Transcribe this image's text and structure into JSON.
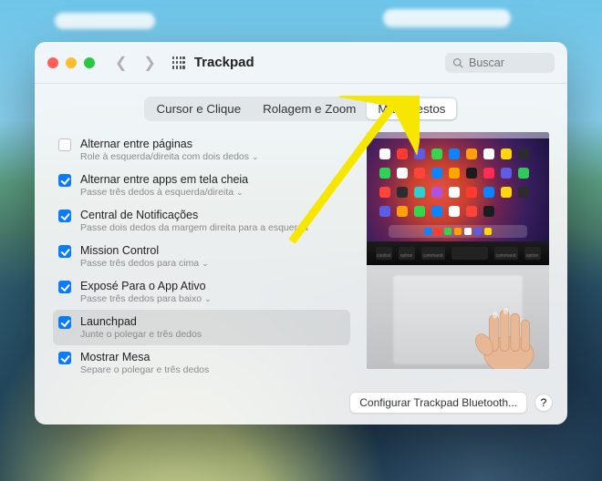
{
  "window": {
    "title": "Trackpad"
  },
  "search": {
    "placeholder": "Buscar"
  },
  "tabs": [
    {
      "label": "Cursor e Clique",
      "active": false
    },
    {
      "label": "Rolagem e Zoom",
      "active": false
    },
    {
      "label": "Mais Gestos",
      "active": true
    }
  ],
  "options": [
    {
      "checked": false,
      "title": "Alternar entre páginas",
      "sub": "Role à esquerda/direita com dois dedos",
      "dropdown": true,
      "selected": false
    },
    {
      "checked": true,
      "title": "Alternar entre apps em tela cheia",
      "sub": "Passe três dedos à esquerda/direita",
      "dropdown": true,
      "selected": false
    },
    {
      "checked": true,
      "title": "Central de Notificações",
      "sub": "Passe dois dedos da margem direita para a esquerda",
      "dropdown": false,
      "selected": false
    },
    {
      "checked": true,
      "title": "Mission Control",
      "sub": "Passe três dedos para cima",
      "dropdown": true,
      "selected": false
    },
    {
      "checked": true,
      "title": "Exposé Para o App Ativo",
      "sub": "Passe três dedos para baixo",
      "dropdown": true,
      "selected": false
    },
    {
      "checked": true,
      "title": "Launchpad",
      "sub": "Junte o polegar e três dedos",
      "dropdown": false,
      "selected": true
    },
    {
      "checked": true,
      "title": "Mostrar Mesa",
      "sub": "Separe o polegar e três dedos",
      "dropdown": false,
      "selected": false
    }
  ],
  "keys": [
    "control",
    "option",
    "command",
    "command",
    "option"
  ],
  "footer": {
    "bluetooth": "Configurar Trackpad Bluetooth...",
    "help": "?"
  },
  "annotation_arrow": true
}
